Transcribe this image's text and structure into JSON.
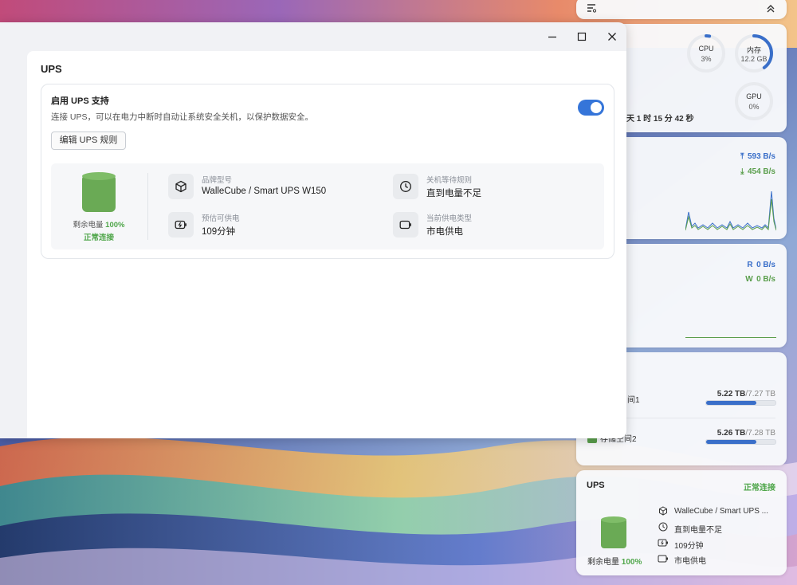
{
  "window": {
    "page_title": "UPS",
    "enable_title": "启用 UPS 支持",
    "enable_desc": "连接 UPS，可以在电力中断时自动让系统安全关机，以保护数据安全。",
    "toggle_on": true,
    "edit_button": "编辑 UPS 规则",
    "battery_label": "剩余电量",
    "battery_value": "100%",
    "battery_level": 1.0,
    "connection_status": "正常连接",
    "info": {
      "brand_label": "品牌型号",
      "brand_value": "WalleCube / Smart UPS W150",
      "shutdown_label": "关机等待规则",
      "shutdown_value": "直到电量不足",
      "runtime_label": "预估可供电",
      "runtime_value": "109分钟",
      "power_type_label": "当前供电类型",
      "power_type_value": "市电供电"
    }
  },
  "widgets": {
    "stats": {
      "cpu_label": "CPU",
      "cpu_value": "3%",
      "cpu_fraction": 0.03,
      "mem_label": "内存",
      "mem_value": "12.2 GB",
      "mem_fraction": 0.4,
      "gpu_label": "GPU",
      "gpu_value": "0%",
      "gpu_fraction": 0.0,
      "uptime": "天 1 时 15 分 42 秒"
    },
    "network": {
      "upload": "593 B/s",
      "download": "454 B/s"
    },
    "disk_io": {
      "read_label": "R",
      "read_value": "0 B/s",
      "write_label": "W",
      "write_value": "0 B/s"
    },
    "storage": {
      "items": [
        {
          "name": "间1",
          "used": "5.22 TB",
          "total": "/7.27 TB",
          "fraction": 0.72
        },
        {
          "name": "存储空间2",
          "used": "5.26 TB",
          "total": "/7.28 TB",
          "fraction": 0.72
        }
      ]
    },
    "ups": {
      "title": "UPS",
      "status": "正常连接",
      "model": "WalleCube / Smart UPS ...",
      "shutdown_rule": "直到电量不足",
      "runtime": "109分钟",
      "power_type": "市电供电",
      "battery_label": "剩余电量",
      "battery_value": "100%"
    }
  },
  "colors": {
    "accent": "#3575d9",
    "success": "#4fa64a",
    "battery": "#6aaa55"
  }
}
